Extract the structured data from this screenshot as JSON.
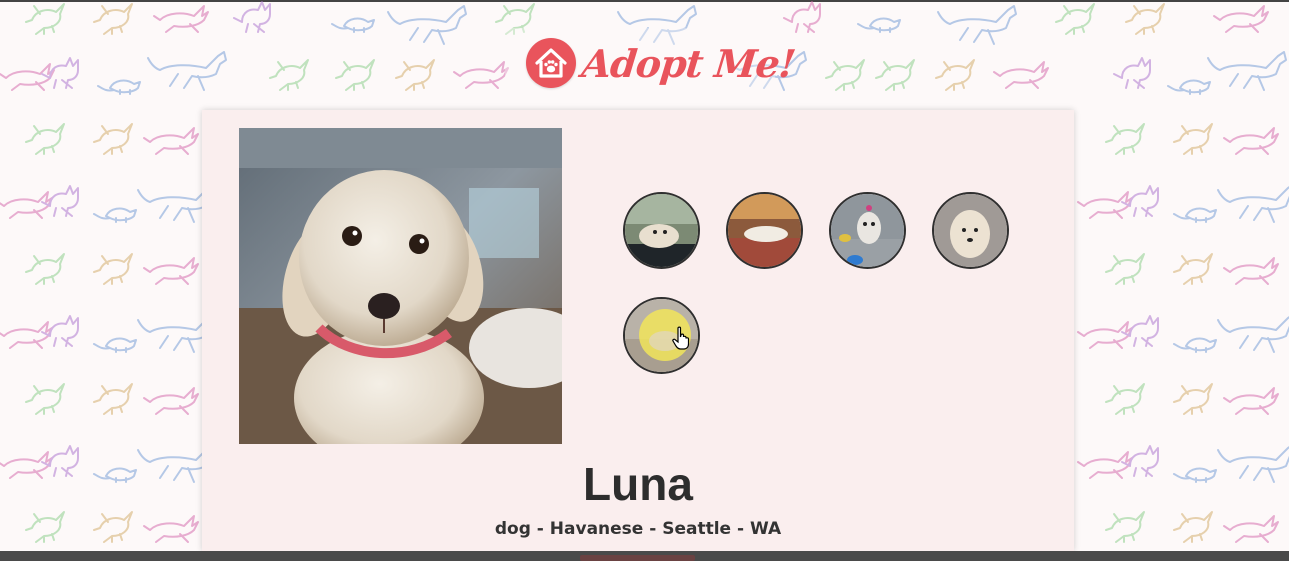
{
  "header": {
    "logo_text": "Adopt Me!",
    "brand_color": "#e9545c",
    "logo_icon": "house-paw-icon"
  },
  "pet": {
    "name": "Luna",
    "animal": "dog",
    "breed": "Havanese",
    "city": "Seattle",
    "state": "WA",
    "meta_line": "dog - Havanese - Seattle - WA",
    "hero_image": "havanese-dog-photo",
    "thumbnails": [
      {
        "name": "thumbnail-1",
        "desc": "dog-lying-on-bed"
      },
      {
        "name": "thumbnail-2",
        "desc": "dog-on-couch"
      },
      {
        "name": "thumbnail-3",
        "desc": "dog-with-toys"
      },
      {
        "name": "thumbnail-4",
        "desc": "dog-portrait"
      },
      {
        "name": "thumbnail-5",
        "desc": "dog-on-rug-highlighted"
      }
    ]
  },
  "colors": {
    "card_background": "#faeeee",
    "page_background": "#fdf9f9",
    "text": "#2d2d2d"
  }
}
